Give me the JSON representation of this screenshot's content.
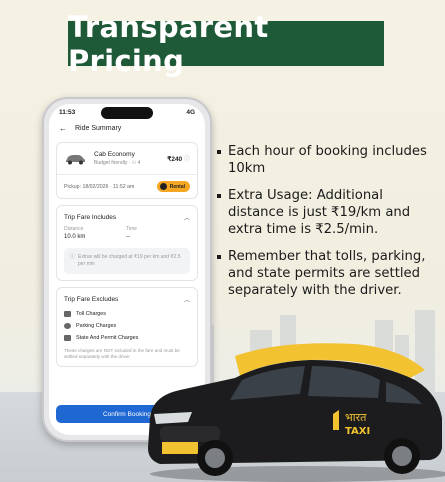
{
  "banner": {
    "title": "Transparent Pricing"
  },
  "bullets": [
    "Each hour of booking includes 10km",
    "Extra Usage: Additional distance is just ₹19/km and extra time is ₹2.5/min.",
    "Remember that tolls, parking, and state permits are settled separately with the driver."
  ],
  "phone": {
    "status_time": "11:53",
    "status_right": "4G",
    "app_title": "Ride Summary",
    "ride": {
      "name": "Cab Economy",
      "subtitle": "Budget friendly · ⚇ 4",
      "price": "₹240",
      "pickup": "Pickup: 18/02/2026 · 11:52 am",
      "badge": "Rental"
    },
    "includes": {
      "title": "Trip Fare Includes",
      "distance_label": "Distance",
      "distance_value": "10.0 km",
      "time_label": "Time",
      "time_value": "--",
      "note": "Extras will be charged at ₹19 per km and ₹2.5 per min"
    },
    "excludes": {
      "title": "Trip Fare Excludes",
      "items": [
        "Toll Charges",
        "Parking Charges",
        "State And Permit Charges"
      ],
      "note": "These charges are NOT included in the fare and must be settled separately with the driver"
    },
    "confirm_label": "Confirm Booking"
  },
  "car_branding": {
    "hindi": "भारत",
    "english": "TAXI"
  },
  "colors": {
    "banner_bg": "#1f5a38",
    "confirm": "#1f67d2",
    "rental_badge": "#f5a623",
    "taxi_roof": "#f2c230"
  }
}
